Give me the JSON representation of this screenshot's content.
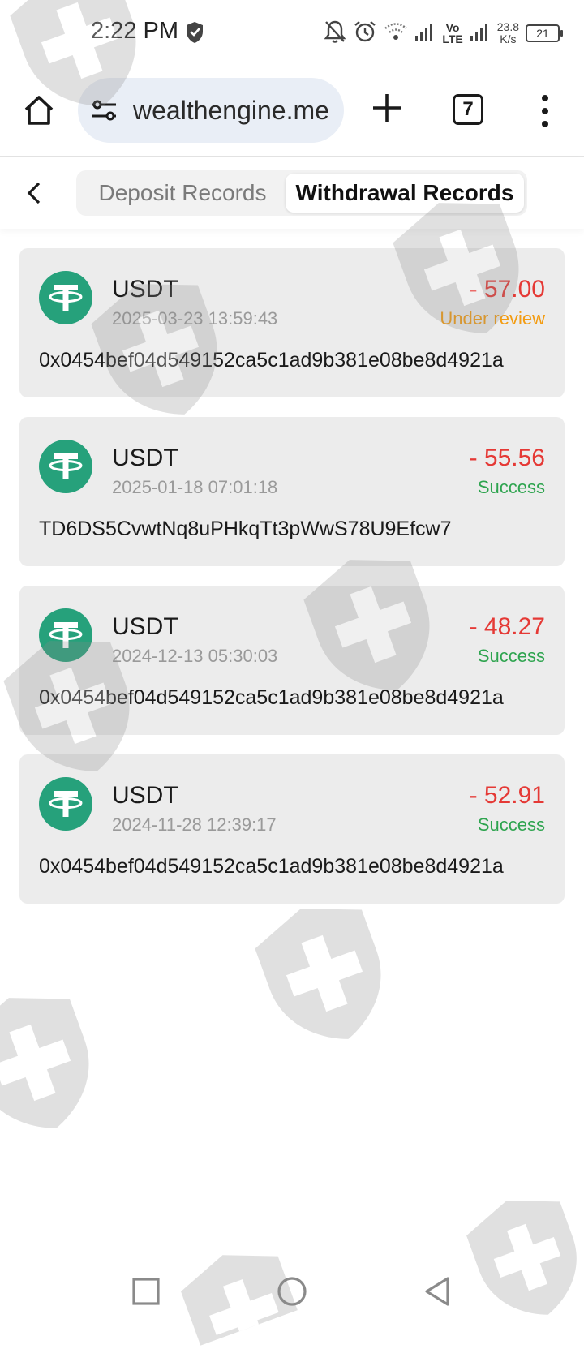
{
  "status_bar": {
    "time": "2:22 PM",
    "network_type_top": "Vo",
    "network_type_bottom": "LTE",
    "speed_value": "23.8",
    "speed_unit": "K/s",
    "battery_level": "21"
  },
  "browser": {
    "url": "wealthengine.me",
    "tab_count": "7"
  },
  "header": {
    "tabs": [
      {
        "label": "Deposit Records",
        "active": false
      },
      {
        "label": "Withdrawal Records",
        "active": true
      }
    ]
  },
  "records": [
    {
      "coin": "USDT",
      "datetime": "2025-03-23 13:59:43",
      "amount": "- 57.00",
      "status": "Under review",
      "address": "0x0454bef04d549152ca5c1ad9b381e08be8d4921a"
    },
    {
      "coin": "USDT",
      "datetime": "2025-01-18 07:01:18",
      "amount": "- 55.56",
      "status": "Success",
      "address": "TD6DS5CvwtNq8uPHkqTt3pWwS78U9Efcw7"
    },
    {
      "coin": "USDT",
      "datetime": "2024-12-13 05:30:03",
      "amount": "- 48.27",
      "status": "Success",
      "address": "0x0454bef04d549152ca5c1ad9b381e08be8d4921a"
    },
    {
      "coin": "USDT",
      "datetime": "2024-11-28 12:39:17",
      "amount": "- 52.91",
      "status": "Success",
      "address": "0x0454bef04d549152ca5c1ad9b381e08be8d4921a"
    }
  ],
  "colors": {
    "amount": "#e53935",
    "status_review": "#f39c12",
    "status_success": "#2ea44f",
    "tether_green": "#26a17b"
  },
  "icons": {
    "home": "home-icon",
    "site_settings": "tune-icon",
    "new_tab": "plus-icon",
    "menu": "more-vert-icon",
    "back": "chevron-left-icon",
    "coin": "tether-icon",
    "watermark": "shield-plus-icon"
  }
}
